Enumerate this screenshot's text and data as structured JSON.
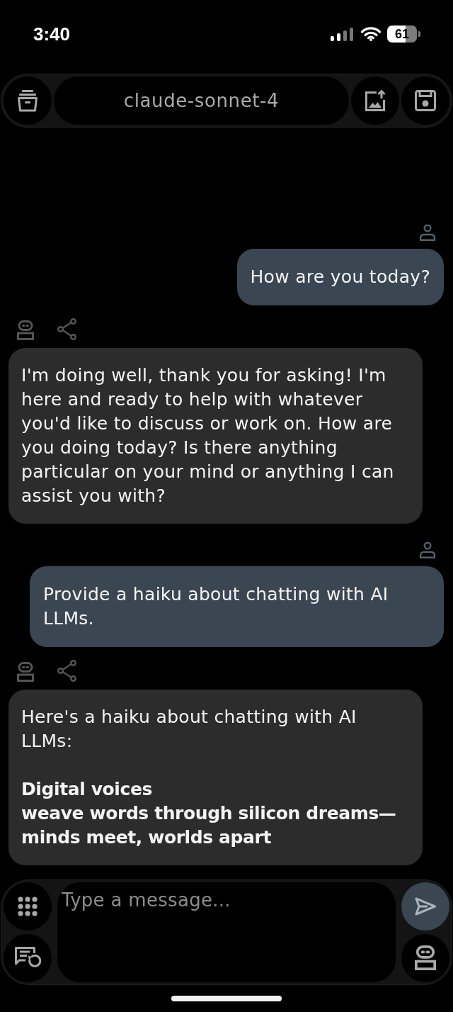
{
  "status_bar": {
    "time": "3:40",
    "battery": "61"
  },
  "toolbar": {
    "model": "claude-sonnet-4"
  },
  "messages": [
    {
      "kind": "user",
      "paragraphs": [
        {
          "text": "How are you today?",
          "bold": false
        }
      ]
    },
    {
      "kind": "assistant",
      "paragraphs": [
        {
          "text": "I'm doing well, thank you for asking! I'm here and ready to help with whatever you'd like to discuss or work on. How are you doing today? Is there anything particular on your mind or anything I can assist you with?",
          "bold": false
        }
      ]
    },
    {
      "kind": "user",
      "paragraphs": [
        {
          "text": "Provide a haiku about chatting with AI LLMs.",
          "bold": false
        }
      ]
    },
    {
      "kind": "assistant",
      "paragraphs": [
        {
          "text": "Here's a haiku about chatting with AI LLMs:",
          "bold": false
        },
        {
          "text": "Digital voices\nweave words through silicon dreams—\nminds meet, worlds apart",
          "bold": true
        }
      ]
    }
  ],
  "composer": {
    "placeholder": "Type a message..."
  }
}
